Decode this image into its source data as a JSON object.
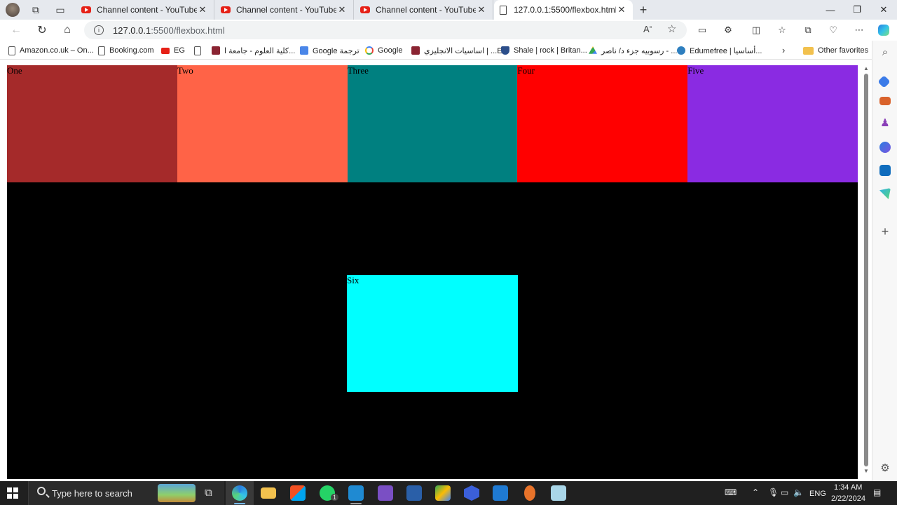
{
  "browser": {
    "tabs": [
      {
        "title": "Channel content - YouTube Studio",
        "icon": "youtube-icon",
        "active": false
      },
      {
        "title": "Channel content - YouTube Studio",
        "icon": "youtube-icon",
        "active": false
      },
      {
        "title": "Channel content - YouTube Studio",
        "icon": "youtube-icon",
        "active": false
      },
      {
        "title": "127.0.0.1:5500/flexbox.html",
        "icon": "page-icon",
        "active": true
      }
    ],
    "address": {
      "host": "127.0.0.1",
      "path": ":5500/flexbox.html"
    },
    "favorites": [
      {
        "label": "Amazon.co.uk – On...",
        "icon": "page"
      },
      {
        "label": "Booking.com",
        "icon": "page"
      },
      {
        "label": "EG",
        "icon": "youtube"
      },
      {
        "label": "",
        "icon": "page"
      },
      {
        "label": "كلية العلوم - جامعة ا...",
        "icon": "university"
      },
      {
        "label": "Google ترجمة",
        "icon": "google-translate"
      },
      {
        "label": "Google",
        "icon": "google"
      },
      {
        "label": "اساسيات الانجليزي | ...E",
        "icon": "university"
      },
      {
        "label": "Shale | rock | Britan...",
        "icon": "shield"
      },
      {
        "label": "رسوبيه جزء د/ ناصر - ...",
        "icon": "drive"
      },
      {
        "label": "Edumefree | أساسيا...",
        "icon": "edu"
      }
    ],
    "other_favorites": "Other favorites"
  },
  "page": {
    "boxes": [
      {
        "label": "One",
        "color": "#a52a2a"
      },
      {
        "label": "Two",
        "color": "#ff6347"
      },
      {
        "label": "Three",
        "color": "#008080"
      },
      {
        "label": "Four",
        "color": "#ff0000"
      },
      {
        "label": "Five",
        "color": "#8a2be2"
      }
    ],
    "box_six": {
      "label": "Six",
      "color": "#00ffff"
    },
    "background": "#000000"
  },
  "taskbar": {
    "search_placeholder": "Type here to search",
    "whatsapp_badge": "1",
    "language": "ENG",
    "time": "1:34 AM",
    "date": "2/22/2024"
  }
}
